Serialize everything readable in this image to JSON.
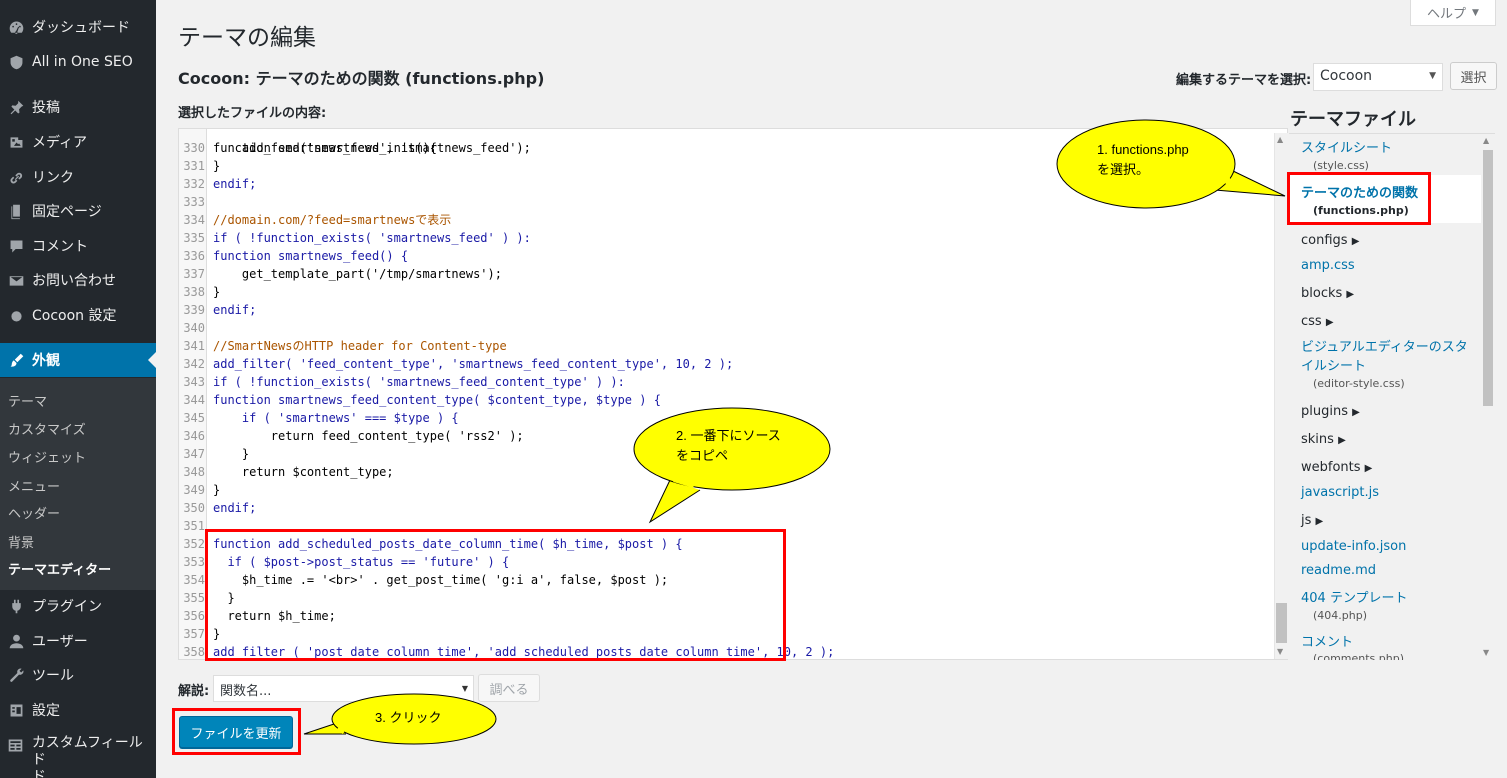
{
  "sidebar": {
    "top_items": [
      {
        "label": "ダッシュボード",
        "icon": "dashboard-icon"
      },
      {
        "label": "All in One SEO",
        "icon": "shield-icon"
      },
      {
        "label": "投稿",
        "icon": "pin-icon"
      },
      {
        "label": "メディア",
        "icon": "media-icon"
      },
      {
        "label": "リンク",
        "icon": "link-icon"
      },
      {
        "label": "固定ページ",
        "icon": "page-icon"
      },
      {
        "label": "コメント",
        "icon": "comment-icon"
      },
      {
        "label": "お問い合わせ",
        "icon": "mail-icon"
      },
      {
        "label": "Cocoon 設定",
        "icon": "circle-icon"
      }
    ],
    "active_item": {
      "label": "外観",
      "icon": "brush-icon"
    },
    "submenu": [
      "テーマ",
      "カスタマイズ",
      "ウィジェット",
      "メニュー",
      "ヘッダー",
      "背景",
      "テーマエディター"
    ],
    "bottom_items": [
      {
        "label": "プラグイン",
        "icon": "plugin-icon"
      },
      {
        "label": "ユーザー",
        "icon": "user-icon"
      },
      {
        "label": "ツール",
        "icon": "wrench-icon"
      },
      {
        "label": "設定",
        "icon": "settings-icon"
      },
      {
        "label": "カスタムフィールド",
        "label_line2": "ド",
        "icon": "table-icon"
      }
    ]
  },
  "header": {
    "help_label": "ヘルプ",
    "page_title": "テーマの編集",
    "file_title": "Cocoon: テーマのための関数 (functions.php)",
    "theme_select_label": "編集するテーマを選択:",
    "theme_select_value": "Cocoon",
    "select_button": "選択",
    "content_label": "選択したファイルの内容:"
  },
  "editor": {
    "partial_top_line": "function smartnews_feed_init(){",
    "lines": [
      {
        "n": "330",
        "t": "    add_feed('smartnews', 'smartnews_feed');"
      },
      {
        "n": "331",
        "t": "}"
      },
      {
        "n": "332",
        "t": "endif;"
      },
      {
        "n": "333",
        "t": ""
      },
      {
        "n": "334",
        "t": "//domain.com/?feed=smartnewsで表示"
      },
      {
        "n": "335",
        "t": "if ( !function_exists( 'smartnews_feed' ) ):"
      },
      {
        "n": "336",
        "t": "function smartnews_feed() {"
      },
      {
        "n": "337",
        "t": "    get_template_part('/tmp/smartnews');"
      },
      {
        "n": "338",
        "t": "}"
      },
      {
        "n": "339",
        "t": "endif;"
      },
      {
        "n": "340",
        "t": ""
      },
      {
        "n": "341",
        "t": "//SmartNewsのHTTP header for Content-type"
      },
      {
        "n": "342",
        "t": "add_filter( 'feed_content_type', 'smartnews_feed_content_type', 10, 2 );"
      },
      {
        "n": "343",
        "t": "if ( !function_exists( 'smartnews_feed_content_type' ) ):"
      },
      {
        "n": "344",
        "t": "function smartnews_feed_content_type( $content_type, $type ) {"
      },
      {
        "n": "345",
        "t": "    if ( 'smartnews' === $type ) {"
      },
      {
        "n": "346",
        "t": "        return feed_content_type( 'rss2' );"
      },
      {
        "n": "347",
        "t": "    }"
      },
      {
        "n": "348",
        "t": "    return $content_type;"
      },
      {
        "n": "349",
        "t": "}"
      },
      {
        "n": "350",
        "t": "endif;"
      },
      {
        "n": "351",
        "t": ""
      },
      {
        "n": "352",
        "t": "function add_scheduled_posts_date_column_time( $h_time, $post ) {"
      },
      {
        "n": "353",
        "t": "  if ( $post->post_status == 'future' ) {"
      },
      {
        "n": "354",
        "t": "    $h_time .= '<br>' . get_post_time( 'g:i a', false, $post );"
      },
      {
        "n": "355",
        "t": "  }"
      },
      {
        "n": "356",
        "t": "  return $h_time;"
      },
      {
        "n": "357",
        "t": "}"
      },
      {
        "n": "358",
        "t": "add_filter ( 'post_date_column_time', 'add_scheduled_posts_date_column_time', 10, 2 );"
      }
    ]
  },
  "theme_files": {
    "heading": "テーマファイル",
    "items": [
      {
        "label": "スタイルシート",
        "sub": "(style.css)",
        "kind": "link"
      },
      {
        "label": "テーマのための関数",
        "sub": "(functions.php)",
        "kind": "current"
      },
      {
        "label": "configs",
        "kind": "folder"
      },
      {
        "label": "amp.css",
        "kind": "link"
      },
      {
        "label": "blocks",
        "kind": "folder"
      },
      {
        "label": "css",
        "kind": "folder"
      },
      {
        "label": "ビジュアルエディターのスタ",
        "label_line2": "イルシート",
        "sub": "(editor-style.css)",
        "kind": "link"
      },
      {
        "label": "plugins",
        "kind": "folder"
      },
      {
        "label": "skins",
        "kind": "folder"
      },
      {
        "label": "webfonts",
        "kind": "folder"
      },
      {
        "label": "javascript.js",
        "kind": "link"
      },
      {
        "label": "js",
        "kind": "folder"
      },
      {
        "label": "update-info.json",
        "kind": "link"
      },
      {
        "label": "readme.md",
        "kind": "link"
      },
      {
        "label": "404 テンプレート",
        "sub": "(404.php)",
        "kind": "link"
      },
      {
        "label": "コメント",
        "sub": "(comments.php)",
        "kind": "link"
      }
    ]
  },
  "bottom": {
    "doc_label": "解説:",
    "doc_select_value": "関数名...",
    "lookup_button": "調べる",
    "update_button": "ファイルを更新"
  },
  "annotations": {
    "callout1_line1": "1. functions.php",
    "callout1_line2": "を選択。",
    "callout2_line1": "2. 一番下にソース",
    "callout2_line2": "をコピペ",
    "callout3": "3. クリック",
    "callout_fill": "#ffff00",
    "box_color": "#ff0000"
  }
}
